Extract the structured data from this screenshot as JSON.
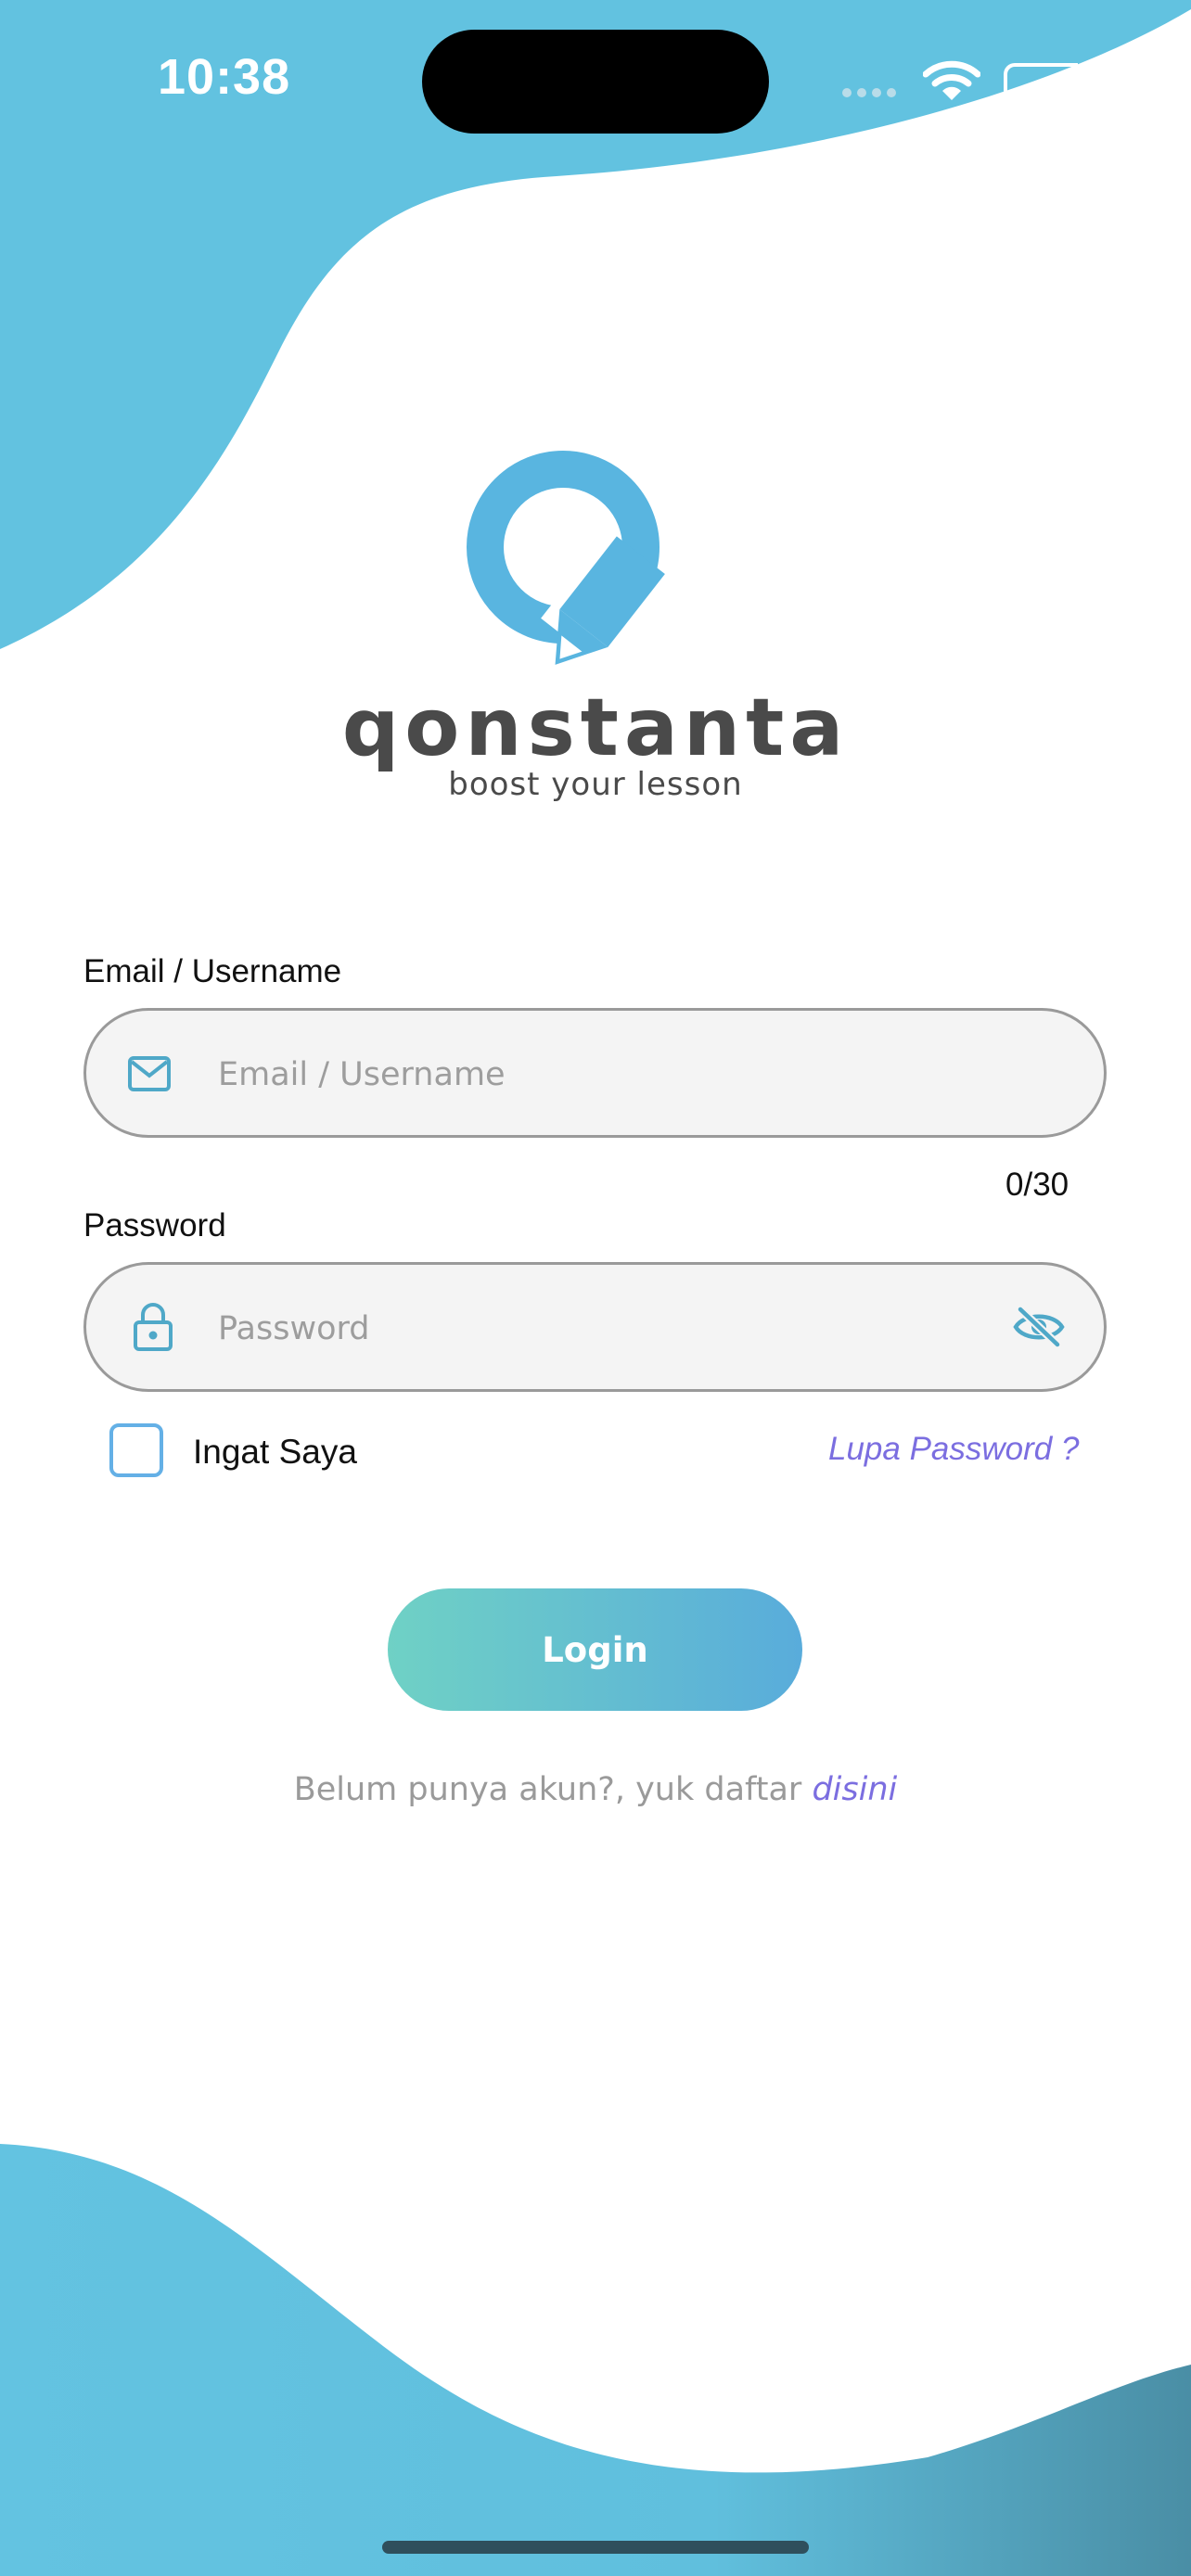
{
  "status_bar": {
    "time": "10:38"
  },
  "brand": {
    "name": "qonstanta",
    "tagline": "boost your lesson"
  },
  "form": {
    "email": {
      "label": "Email / Username",
      "placeholder": "Email / Username",
      "value": ""
    },
    "counter": "0/30",
    "password": {
      "label": "Password",
      "placeholder": "Password",
      "value": ""
    },
    "remember_label": "Ingat Saya",
    "remember_checked": false,
    "forgot_label": "Lupa Password ?",
    "login_label": "Login",
    "signup_text": "Belum punya akun?, yuk daftar",
    "signup_link": "disini"
  },
  "colors": {
    "accent": "#62c2e0",
    "accent_dark": "#4a90a8",
    "link": "#7b6ee0",
    "button_gradient_start": "#6fd1c5",
    "button_gradient_end": "#59acdb"
  }
}
